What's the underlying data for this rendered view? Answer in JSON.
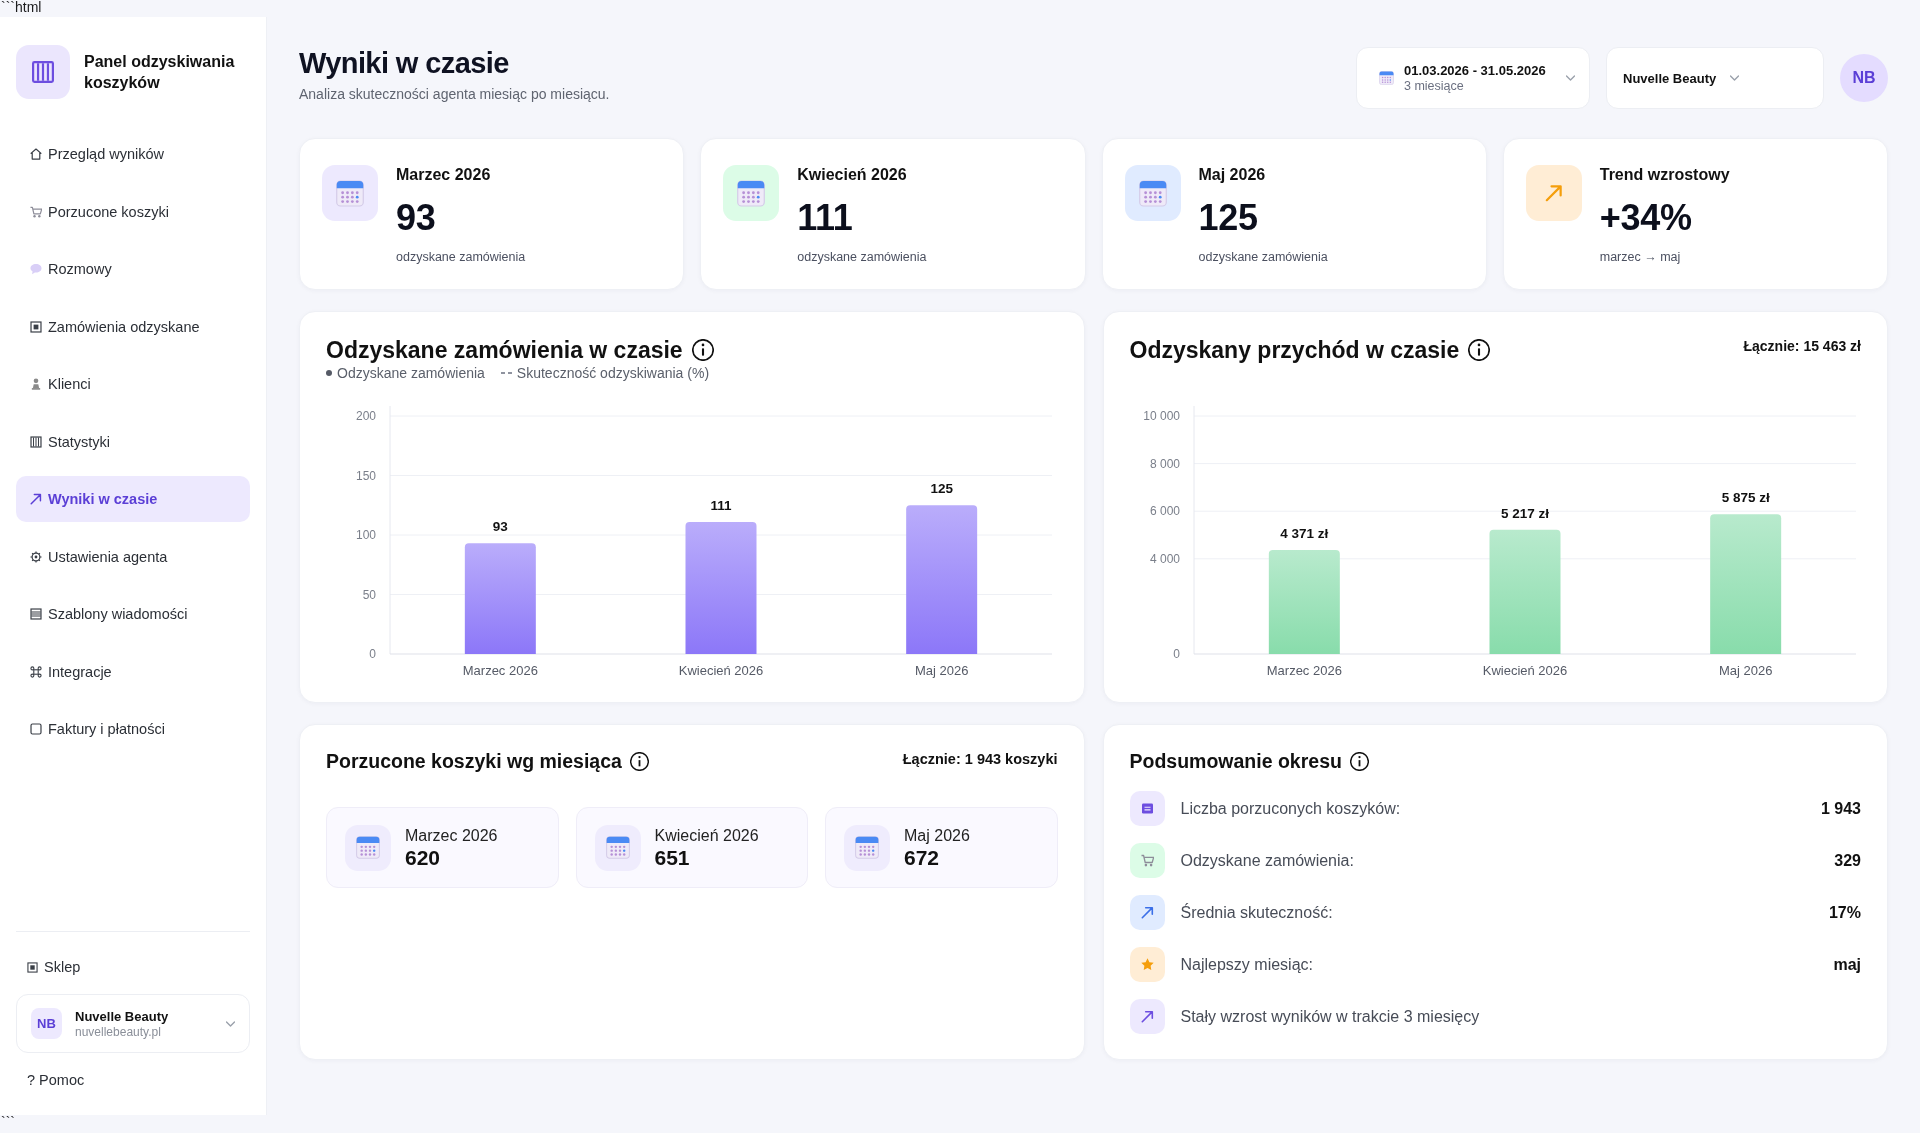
{
  "code_fence": {
    "opening": "```html",
    "closing": "```"
  },
  "sidebar": {
    "title": "Panel odzyskiwania koszyków",
    "nav_items": [
      {
        "label": "Przegląd wyników",
        "selected": false
      },
      {
        "label": "Porzucone koszyki",
        "selected": false
      },
      {
        "label": "Rozmowy",
        "selected": false
      },
      {
        "label": "Zamówienia odzyskane",
        "selected": false
      },
      {
        "label": "Klienci",
        "selected": false
      },
      {
        "label": "Statystyki",
        "selected": false
      },
      {
        "label": "Wyniki w czasie",
        "selected": true
      },
      {
        "label": "Ustawienia agenta",
        "selected": false
      },
      {
        "label": "Szablony wiadomości",
        "selected": false
      },
      {
        "label": "Integracje",
        "selected": false
      },
      {
        "label": "Faktury i płatności",
        "selected": false
      }
    ],
    "shop_link": "Sklep",
    "account": {
      "initials": "NB",
      "name": "Nuvelle Beauty",
      "domain": "nuvellebeauty.pl"
    },
    "help_link": "? Pomoc"
  },
  "header": {
    "title": "Wyniki w czasie",
    "subtitle": "Analiza skuteczności agenta miesiąc po miesiącu.",
    "date_range": {
      "value": "01.03.2026 - 31.05.2026",
      "caption": "3 miesiące"
    },
    "store_select": {
      "value": "Nuvelle Beauty"
    },
    "avatar": {
      "initials": "NB"
    }
  },
  "kpi_cards": [
    {
      "kind": "month",
      "title": "Marzec 2026",
      "value": "93",
      "caption": "odzyskane zamówienia",
      "color": "#ede9fe"
    },
    {
      "kind": "month",
      "title": "Kwiecień 2026",
      "value": "111",
      "caption": "odzyskane zamówienia",
      "color": "#dcfce7"
    },
    {
      "kind": "month",
      "title": "Maj 2026",
      "value": "125",
      "caption": "odzyskane zamówienia",
      "color": "#e0ebff"
    },
    {
      "kind": "trend",
      "title": "Trend wzrostowy",
      "value": "+34%",
      "caption": "marzec → maj",
      "color": "#ffedd5"
    }
  ],
  "orders_chart": {
    "title": "Odzyskane zamówienia w czasie",
    "legend": [
      {
        "kind": "dot",
        "label": "Odzyskane zamówienia"
      },
      {
        "kind": "dash",
        "label": "Skuteczność odzyskiwania (%)"
      }
    ],
    "chart_data": {
      "type": "bar",
      "categories": [
        "Marzec 2026",
        "Kwiecień 2026",
        "Maj 2026"
      ],
      "series": [
        {
          "color": "#8c77f8",
          "values": [
            93,
            111,
            125
          ]
        }
      ],
      "ylim": [
        0,
        200
      ],
      "yticks": [
        0,
        50,
        100,
        150,
        200
      ],
      "grid": true,
      "data_labels": true
    }
  },
  "revenue_chart": {
    "title": "Odzyskany przychód w czasie",
    "total": "Łącznie: 15 463 zł",
    "chart_data": {
      "type": "bar",
      "categories": [
        "Marzec 2026",
        "Kwiecień 2026",
        "Maj 2026"
      ],
      "series": [
        {
          "color": "#88dcab",
          "values": [
            4371,
            5217,
            5875
          ]
        }
      ],
      "ylim": [
        0,
        10000
      ],
      "yticks": [
        {
          "value": 0,
          "label": "0"
        },
        {
          "value": 4000,
          "label": "4 000"
        },
        {
          "value": 6000,
          "label": "6 000"
        },
        {
          "value": 8000,
          "label": "8 000"
        },
        {
          "value": 10000,
          "label": "10 000"
        }
      ],
      "grid": true,
      "value_labels": [
        "4 371 zł",
        "5 217 zł",
        "5 875 zł"
      ]
    }
  },
  "abandoned_carts": {
    "title": "Porzucone koszyki wg miesiąca",
    "total": "Łącznie: 1 943 koszyki",
    "months": [
      {
        "label": "Marzec 2026",
        "value": "620"
      },
      {
        "label": "Kwiecień 2026",
        "value": "651"
      },
      {
        "label": "Maj 2026",
        "value": "672"
      }
    ]
  },
  "period_summary": {
    "title": "Podsumowanie okresu",
    "rows": [
      {
        "label": "Liczba porzuconych koszyków:",
        "value": "1 943",
        "color": "#ede9fe"
      },
      {
        "label": "Odzyskane zamówienia:",
        "value": "329",
        "color": "#dcfce7"
      },
      {
        "label": "Średnia skuteczność:",
        "value": "17%",
        "color": "#e0ebff"
      },
      {
        "label": "Najlepszy miesiąc:",
        "value": "maj",
        "color": "#ffedd5"
      },
      {
        "label": "Stały wzrost wyników w trakcie 3 miesięcy",
        "color": "#ede9fe"
      }
    ]
  }
}
